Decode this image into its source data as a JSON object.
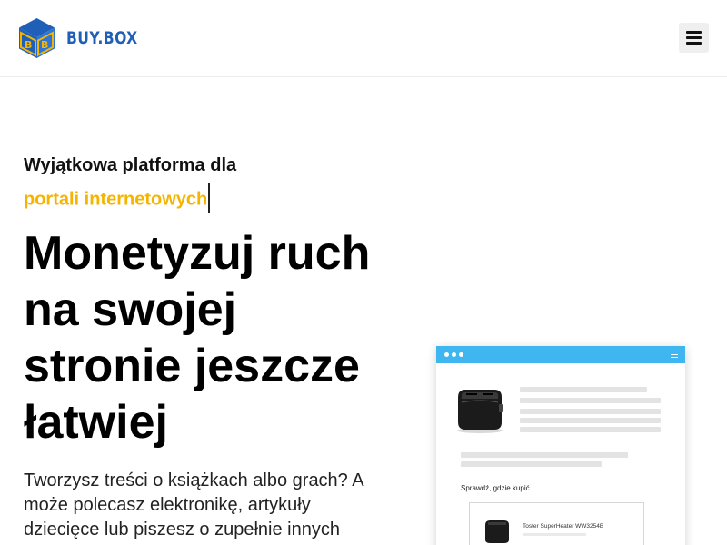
{
  "header": {
    "logo_text": "BUY.BOX",
    "menu_icon": "hamburger-menu-icon"
  },
  "hero": {
    "kicker": "Wyjątkowa platforma dla",
    "kicker_accent": "portali internetowych",
    "headline": "Monetyzuj ruch na swojej stronie jeszcze łatwiej",
    "lead": "Tworzysz treści o książkach albo grach? A może polecasz elektronikę, artykuły dziecięce lub piszesz o zupełnie innych"
  },
  "mockup": {
    "where_to_buy_label": "Sprawdź, gdzie kupić",
    "product_name": "Toster SuperHeater  WW3254B"
  },
  "colors": {
    "brand_blue": "#1f5fb8",
    "accent_yellow": "#f5b400",
    "mock_bar_blue": "#3fb6ef"
  }
}
